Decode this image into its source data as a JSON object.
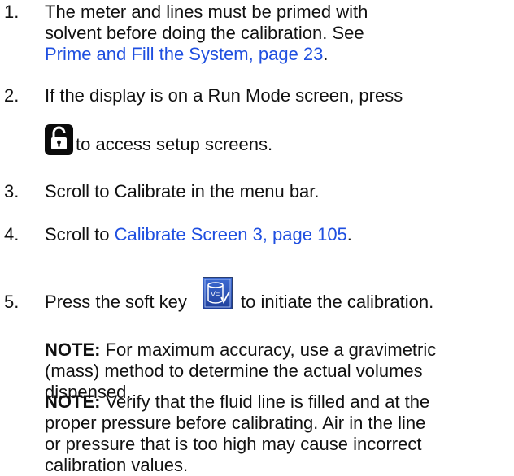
{
  "steps": [
    {
      "number": "1.",
      "lines": [
        "The meter and lines must be primed with",
        "solvent before doing the calibration.  See"
      ],
      "link": "Prime and Fill the System, page 23",
      "after_link": "."
    },
    {
      "number": "2.",
      "line1": "If the display is on a Run Mode screen, press",
      "after_icon": "to access setup screens.",
      "icon": "unlock-key-icon"
    },
    {
      "number": "3.",
      "text": "Scroll to Calibrate in the menu bar."
    },
    {
      "number": "4.",
      "before_link": "Scroll to ",
      "link": "Calibrate Screen 3, page 105",
      "after_link": "."
    },
    {
      "number": "5.",
      "before_icon": "Press the soft key",
      "after_icon": "to initiate the calibration.",
      "icon": "calibrate-softkey-icon"
    }
  ],
  "notes": [
    {
      "label": "NOTE:",
      "lines": [
        " For maximum accuracy, use a gravimetric",
        "(mass) method to determine the actual volumes",
        "dispensed."
      ]
    },
    {
      "label": "NOTE:",
      "lines": [
        " Verify that the fluid line is filled and at the",
        "proper pressure before calibrating. Air in the line",
        "or pressure that is too high may cause incorrect",
        "calibration values."
      ]
    }
  ],
  "colors": {
    "link": "#1f4fe0",
    "softkey": "#3d6bd4"
  }
}
